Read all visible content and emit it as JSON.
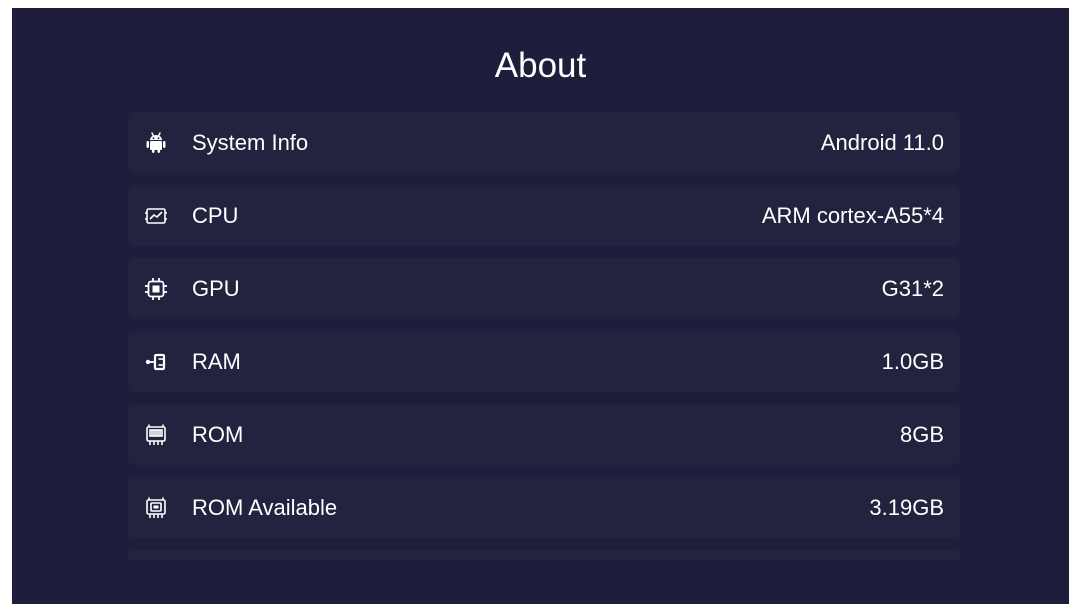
{
  "page": {
    "title": "About"
  },
  "about": {
    "items": [
      {
        "icon": "android-icon",
        "label": "System Info",
        "value": "Android 11.0"
      },
      {
        "icon": "cpu-board-icon",
        "label": "CPU",
        "value": "ARM cortex-A55*4"
      },
      {
        "icon": "chip-icon",
        "label": "GPU",
        "value": "G31*2"
      },
      {
        "icon": "ram-icon",
        "label": "RAM",
        "value": "1.0GB"
      },
      {
        "icon": "storage-icon",
        "label": "ROM",
        "value": "8GB"
      },
      {
        "icon": "storage-available-icon",
        "label": "ROM Available",
        "value": "3.19GB"
      },
      {
        "icon": "",
        "label": "",
        "value": ""
      }
    ]
  },
  "colors": {
    "background": "#1e1d3c",
    "row_background": "#23233f",
    "text": "#ffffff"
  }
}
